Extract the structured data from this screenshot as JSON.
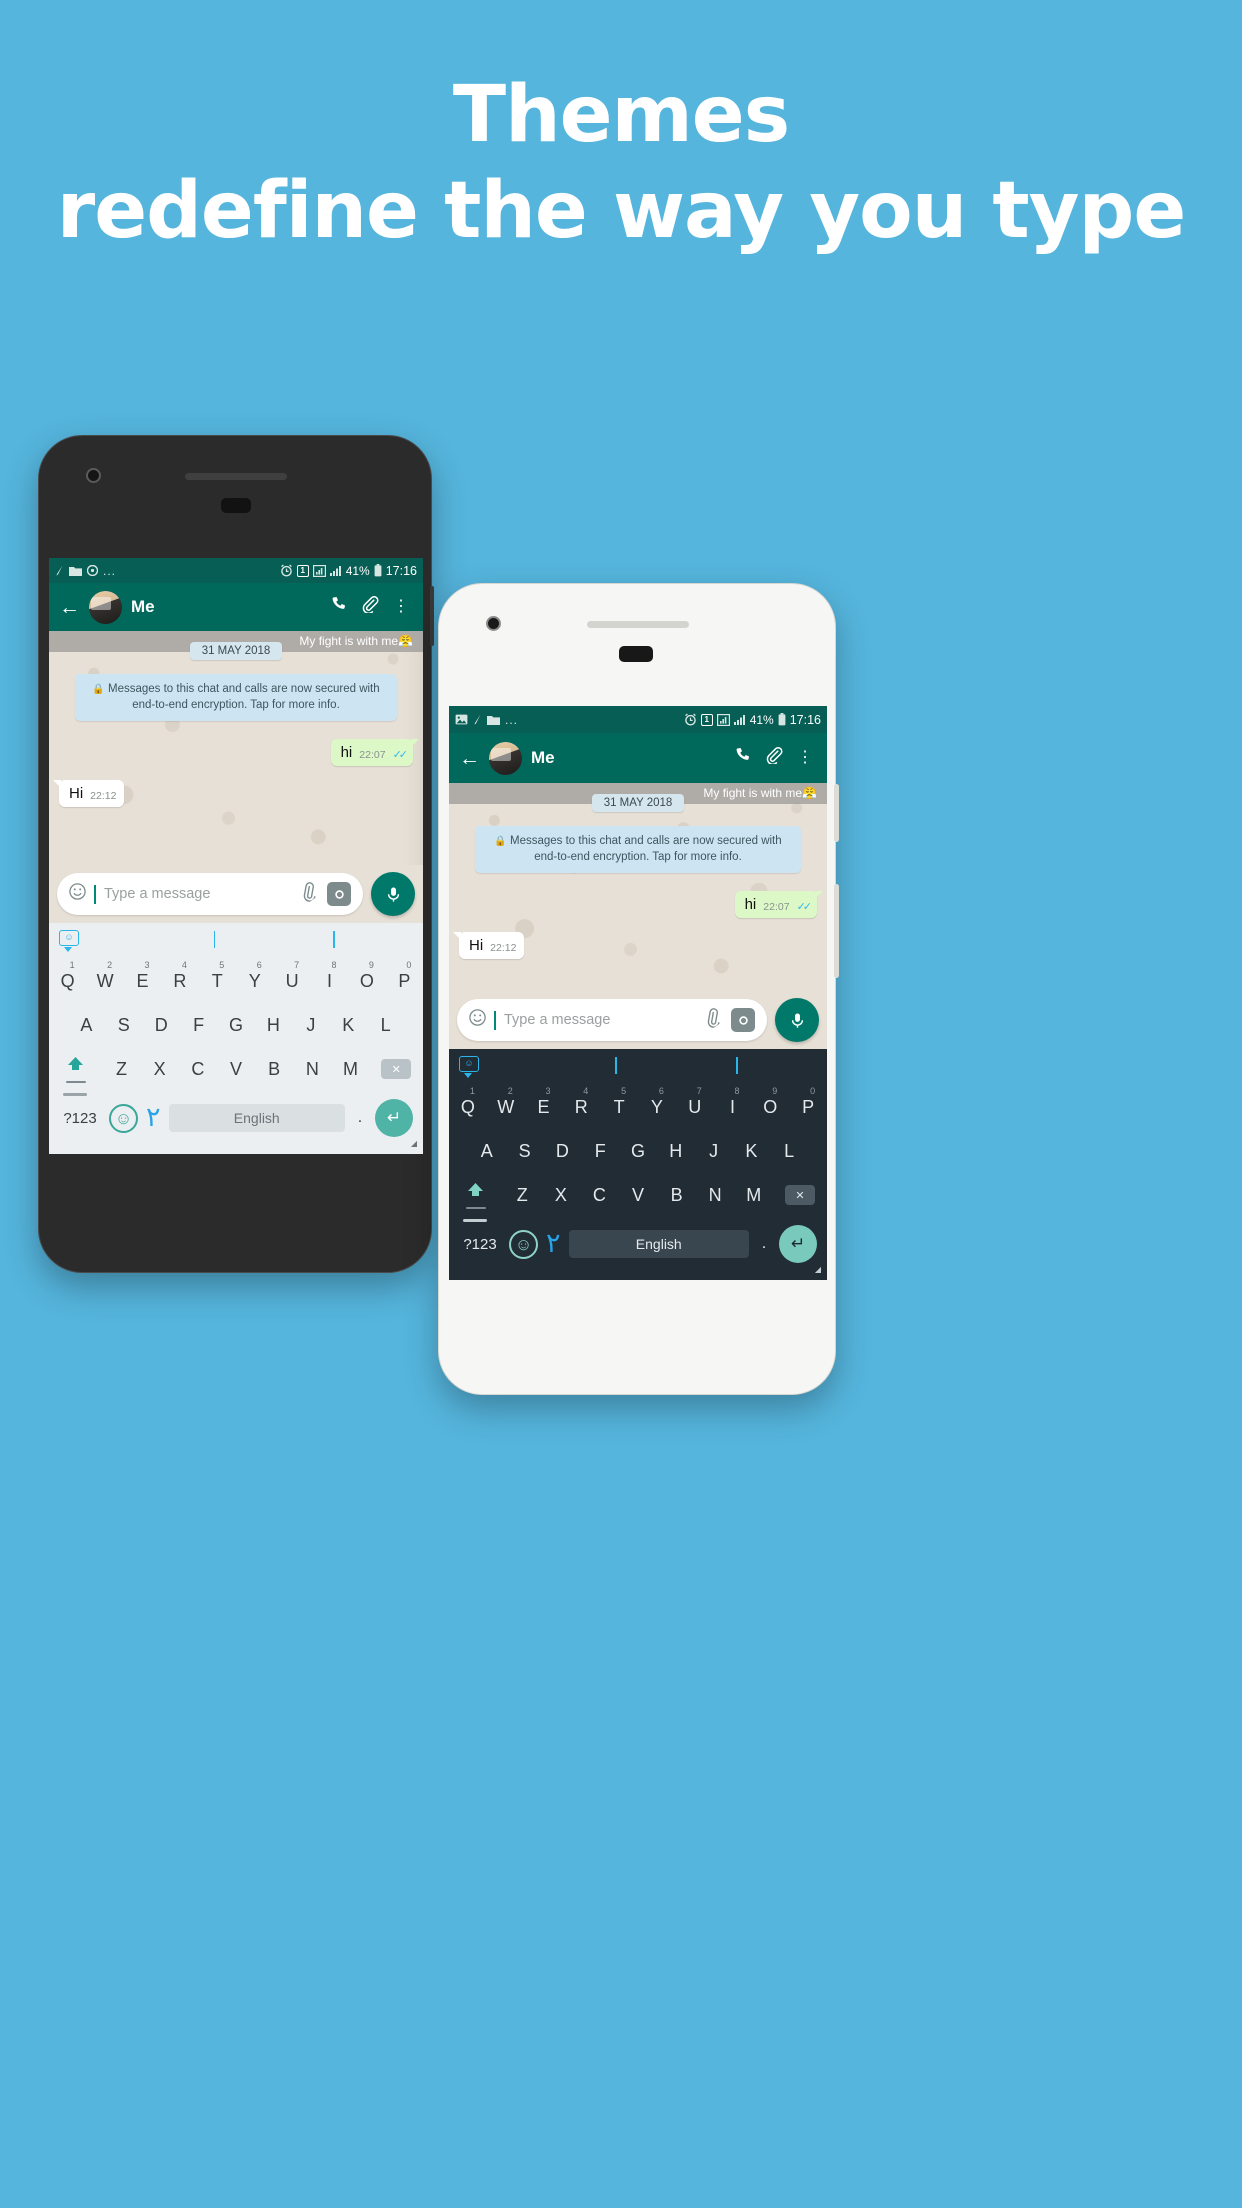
{
  "headline": {
    "line1": "Themes",
    "line2": "redefine the way you type"
  },
  "background_color": "#55b5dd",
  "phones": [
    {
      "id": "dark-phone",
      "frame_color": "#2b2b2b",
      "keyboard_theme": "light"
    },
    {
      "id": "white-phone",
      "frame_color": "#f6f6f4",
      "keyboard_theme": "dark"
    }
  ],
  "status_bar": {
    "left_icons": [
      "image-icon",
      "pen-icon",
      "folder-icon"
    ],
    "overflow": "...",
    "alarm_icon": "alarm-icon",
    "sim_badge": "1",
    "signal_icon_1": "signal-bars-icon",
    "signal_icon_2": "signal-bars-icon",
    "battery_percent": "41%",
    "battery_icon": "battery-icon",
    "time": "17:16"
  },
  "app_bar": {
    "back_label": "←",
    "contact_name": "Me",
    "call_icon": "✆",
    "attach_icon": "📎",
    "menu_icon": "⋮"
  },
  "chat": {
    "notification_text": "My fight is with me😤",
    "date_chip": "31 MAY 2018",
    "encryption_notice": "Messages to this chat and calls are now secured with end-to-end encryption. Tap for more info.",
    "lock_icon": "🔒",
    "messages": [
      {
        "direction": "out",
        "text": "hi",
        "time": "22:07",
        "ticks": "✓✓",
        "tick_color": "#34b7f1"
      },
      {
        "direction": "in",
        "text": "Hi",
        "time": "22:12",
        "ticks": "",
        "tick_color": ""
      }
    ]
  },
  "input_bar": {
    "emoji_icon": "☺",
    "placeholder": "Type a message",
    "attach_icon": "📎",
    "camera_icon": "◉",
    "mic_icon": "🎤"
  },
  "keyboard": {
    "suggestion_sticker_icon": "sticker-smiley-icon",
    "suggestion_face": "˘˘",
    "row1": [
      {
        "key": "Q",
        "num": "1"
      },
      {
        "key": "W",
        "num": "2"
      },
      {
        "key": "E",
        "num": "3"
      },
      {
        "key": "R",
        "num": "4"
      },
      {
        "key": "T",
        "num": "5"
      },
      {
        "key": "Y",
        "num": "6"
      },
      {
        "key": "U",
        "num": "7"
      },
      {
        "key": "I",
        "num": "8"
      },
      {
        "key": "O",
        "num": "9"
      },
      {
        "key": "P",
        "num": "0"
      }
    ],
    "row2": [
      "A",
      "S",
      "D",
      "F",
      "G",
      "H",
      "J",
      "K",
      "L"
    ],
    "row3": [
      "Z",
      "X",
      "C",
      "V",
      "B",
      "N",
      "M"
    ],
    "shift_icon": "⬆",
    "delete_icon": "✕",
    "symbols_key": "?123",
    "emoji_key": "☺",
    "language_glyph": "٢",
    "spacebar_label": "English",
    "period_key": ".",
    "enter_icon": "↵"
  }
}
